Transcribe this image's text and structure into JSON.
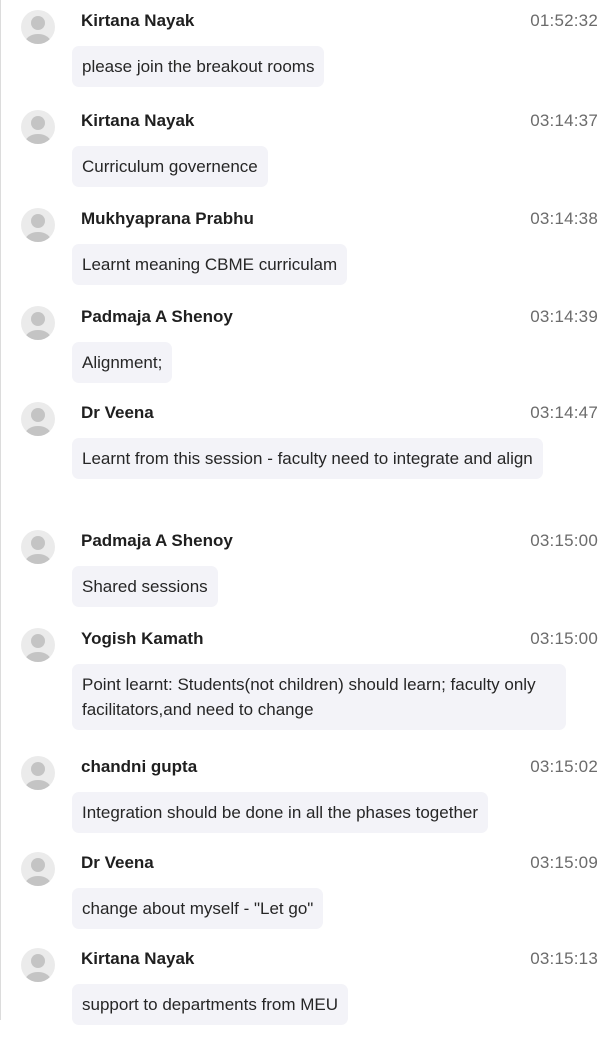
{
  "messages": [
    {
      "sender": "Kirtana Nayak",
      "time": "01:52:32",
      "text": "please join the breakout rooms"
    },
    {
      "sender": "Kirtana Nayak",
      "time": "03:14:37",
      "text": "Curriculum governence"
    },
    {
      "sender": "Mukhyaprana Prabhu",
      "time": "03:14:38",
      "text": "Learnt meaning CBME curriculam"
    },
    {
      "sender": "Padmaja A Shenoy",
      "time": "03:14:39",
      "text": "Alignment;"
    },
    {
      "sender": "Dr Veena",
      "time": "03:14:47",
      "text": "Learnt from this session - faculty need to integrate and align"
    },
    {
      "sender": "Padmaja A Shenoy",
      "time": "03:15:00",
      "text": "Shared sessions"
    },
    {
      "sender": "Yogish Kamath",
      "time": "03:15:00",
      "text": "Point learnt: Students(not children) should learn; faculty only facilitators,and need to change"
    },
    {
      "sender": "chandni gupta",
      "time": "03:15:02",
      "text": "Integration should be done in all the phases together"
    },
    {
      "sender": "Dr Veena",
      "time": "03:15:09",
      "text": "change about myself - \"Let go\""
    },
    {
      "sender": "Kirtana Nayak",
      "time": "03:15:13",
      "text": "support to departments from MEU"
    }
  ],
  "colors": {
    "bubble_bg": "#f3f3f8",
    "avatar_bg": "#ebebeb",
    "avatar_fg": "#c4c4c4",
    "time_text": "#6b6b6b"
  },
  "icons": {
    "avatar": "default-user-avatar-icon"
  }
}
